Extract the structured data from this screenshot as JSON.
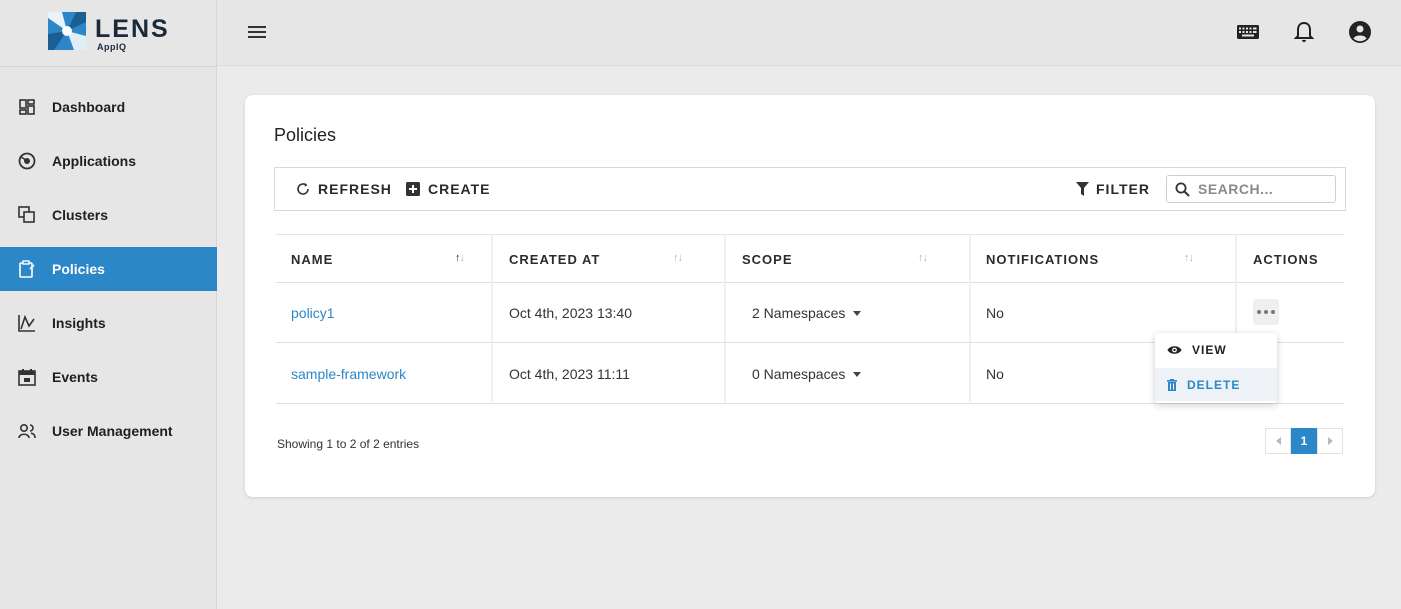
{
  "brand": {
    "name": "LENS",
    "sub": "AppIQ",
    "accent": "#2b87c8"
  },
  "sidebar": {
    "items": [
      {
        "label": "Dashboard",
        "icon": "dashboard-icon",
        "active": false
      },
      {
        "label": "Applications",
        "icon": "applications-icon",
        "active": false
      },
      {
        "label": "Clusters",
        "icon": "clusters-icon",
        "active": false
      },
      {
        "label": "Policies",
        "icon": "policies-icon",
        "active": true
      },
      {
        "label": "Insights",
        "icon": "insights-icon",
        "active": false
      },
      {
        "label": "Events",
        "icon": "events-icon",
        "active": false
      },
      {
        "label": "User Management",
        "icon": "user-management-icon",
        "active": false
      }
    ]
  },
  "topbar": {
    "icons": [
      "menu-icon",
      "keyboard-icon",
      "bell-icon",
      "account-icon"
    ]
  },
  "page": {
    "title": "Policies"
  },
  "toolbar": {
    "refresh_label": "REFRESH",
    "create_label": "CREATE",
    "filter_label": "FILTER",
    "search_placeholder": "SEARCH..."
  },
  "table": {
    "columns": [
      "NAME",
      "CREATED AT",
      "SCOPE",
      "NOTIFICATIONS",
      "ACTIONS"
    ],
    "rows": [
      {
        "name": "policy1",
        "created_at": "Oct 4th, 2023 13:40",
        "scope": "2 Namespaces",
        "notifications": "No"
      },
      {
        "name": "sample-framework",
        "created_at": "Oct 4th, 2023 11:11",
        "scope": "0 Namespaces",
        "notifications": "No"
      }
    ]
  },
  "action_menu": {
    "view_label": "VIEW",
    "delete_label": "DELETE"
  },
  "footer": {
    "showing": "Showing 1 to 2 of 2 entries",
    "current_page": "1"
  }
}
